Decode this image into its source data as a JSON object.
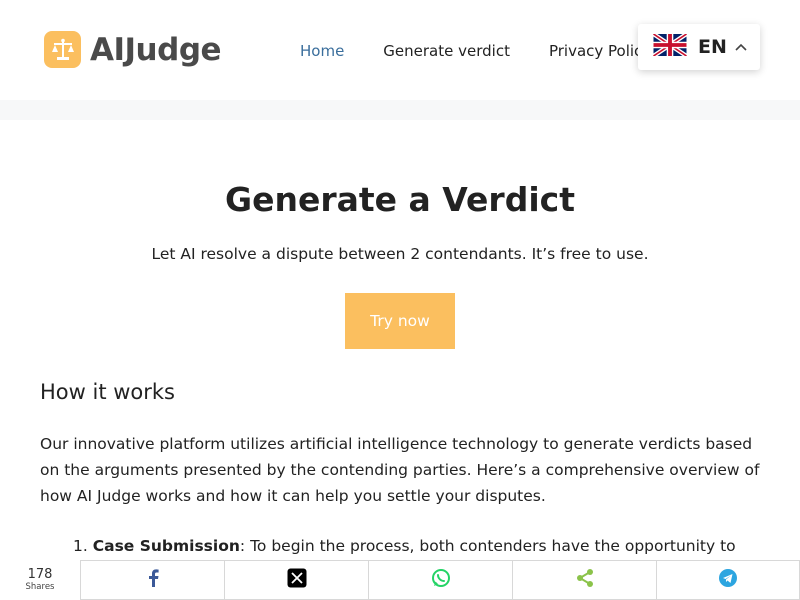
{
  "header": {
    "logo_text": "AIJudge",
    "nav": [
      {
        "label": "Home"
      },
      {
        "label": "Generate verdict"
      },
      {
        "label": "Privacy Policy"
      }
    ],
    "language": {
      "code": "EN"
    }
  },
  "hero": {
    "title": "Generate a Verdict",
    "subtitle": "Let AI resolve a dispute between 2 contendants. It’s free to use.",
    "cta_label": "Try now"
  },
  "how_it_works": {
    "heading": "How it works",
    "paragraph": "Our innovative platform utilizes artificial intelligence technology to generate verdicts based on the arguments presented by the contending parties. Here’s a comprehensive overview of how AI Judge works and how it can help you settle your disputes.",
    "steps": [
      {
        "number": "1.",
        "title": "Case Submission",
        "text": ": To begin the process, both contenders have the opportunity to"
      }
    ]
  },
  "share_bar": {
    "count": "178",
    "count_label": "Shares",
    "buttons": [
      {
        "icon": "facebook-icon",
        "color": "#3b5998"
      },
      {
        "icon": "x-icon",
        "color": "#000000"
      },
      {
        "icon": "whatsapp-icon",
        "color": "#25d366"
      },
      {
        "icon": "share-icon",
        "color": "#8bc34a"
      },
      {
        "icon": "telegram-icon",
        "color": "#2ca5e0"
      }
    ]
  },
  "colors": {
    "accent": "#fbbf5f",
    "nav_active": "#3a6e9c"
  }
}
